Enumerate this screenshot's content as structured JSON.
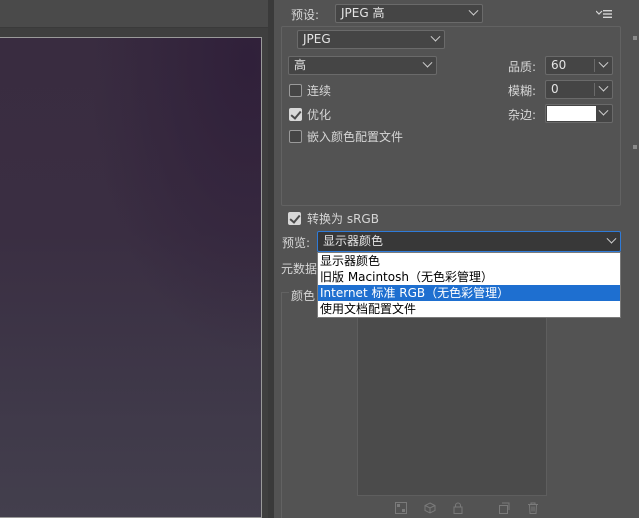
{
  "settings": {
    "preset_label": "预设:",
    "preset_value": "JPEG 高",
    "format_value": "JPEG",
    "quality_preset_value": "高",
    "quality_label": "品质:",
    "quality_value": "60",
    "blur_label": "模糊:",
    "blur_value": "0",
    "matte_label": "杂边:",
    "progressive_label": "连续",
    "progressive_checked": false,
    "optimized_label": "优化",
    "optimized_checked": true,
    "embed_profile_label": "嵌入颜色配置文件",
    "embed_profile_checked": false,
    "convert_srgb_label": "转换为 sRGB",
    "convert_srgb_checked": true,
    "preview_label": "预览:",
    "preview_value": "显示器颜色",
    "metadata_label": "元数据",
    "color_table_label": "颜色"
  },
  "preview_dropdown": {
    "options": [
      "显示器颜色",
      "旧版 Macintosh（无色彩管理）",
      "Internet 标准 RGB（无色彩管理）",
      "使用文档配置文件"
    ],
    "highlighted_index": 2
  },
  "colors": {
    "highlight": "#1e6fd0",
    "panel_bg": "#535353",
    "matte_swatch": "#ffffff"
  },
  "icons": [
    "panel-menu-icon",
    "map-colors-icon",
    "web-shift-icon",
    "lock-icon",
    "new-color-icon",
    "trash-icon"
  ]
}
